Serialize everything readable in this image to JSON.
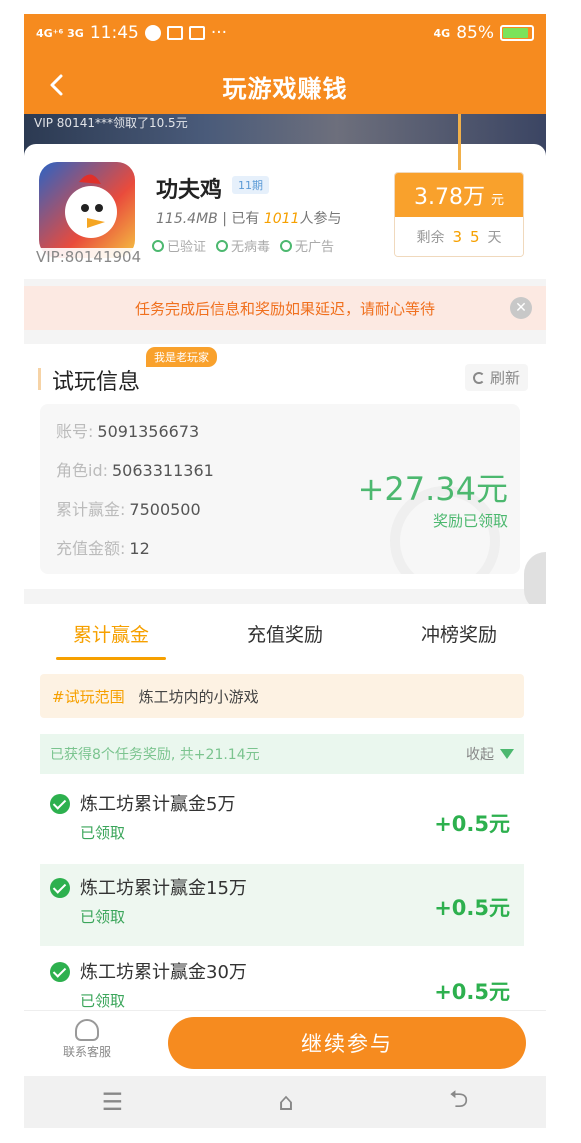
{
  "status_bar": {
    "network_left": "4G⁺⁶ 3G",
    "time": "11:45",
    "more": "···",
    "network_right": "4G",
    "battery": "85%",
    "battery_level": 0.85
  },
  "header": {
    "title": "玩游戏赚钱",
    "back_icon": "chevron-left-icon"
  },
  "banner": {
    "text": "VIP 80141***领取了10.5元"
  },
  "app": {
    "name": "功夫鸡",
    "period_badge": "11期",
    "size": "115.4MB",
    "participants_prefix": "| 已有",
    "participants_count": "1011",
    "participants_suffix": "人参与",
    "vip_id": "VIP:80141904",
    "tags": [
      "已验证",
      "无病毒",
      "无广告"
    ],
    "reward_total": "3.78万",
    "reward_unit": "元",
    "remaining_label": "剩余",
    "remaining_days_1": "3",
    "remaining_days_2": "5",
    "remaining_unit": "天"
  },
  "notice": {
    "text": "任务完成后信息和奖励如果延迟，请耐心等待"
  },
  "trial_info": {
    "title": "试玩信息",
    "badge": "我是老玩家",
    "refresh_label": "刷新",
    "rows": [
      {
        "key": "账号:",
        "value": "5091356673"
      },
      {
        "key": "角色id:",
        "value": "5063311361"
      },
      {
        "key": "累计赢金:",
        "value": "7500500"
      },
      {
        "key": "充值金额:",
        "value": "12"
      }
    ],
    "reward_amount": "+27.34元",
    "reward_status": "奖励已领取"
  },
  "tabs": [
    {
      "label": "累计赢金",
      "active": true
    },
    {
      "label": "充值奖励",
      "active": false
    },
    {
      "label": "冲榜奖励",
      "active": false
    }
  ],
  "range": {
    "key": "#试玩范围",
    "value": "炼工坊内的小游戏"
  },
  "summary": {
    "text": "已获得8个任务奖励, 共+21.14元",
    "collapse_label": "收起"
  },
  "tasks": [
    {
      "name": "炼工坊累计赢金5万",
      "status": "已领取",
      "reward": "+0.5元"
    },
    {
      "name": "炼工坊累计赢金15万",
      "status": "已领取",
      "reward": "+0.5元"
    },
    {
      "name": "炼工坊累计赢金30万",
      "status": "已领取",
      "reward": "+0.5元"
    }
  ],
  "bottom": {
    "service_label": "联系客服",
    "continue_label": "继续参与"
  },
  "nav": {
    "menu": "☰",
    "home": "⌂",
    "back": "⮌"
  },
  "colors": {
    "primary": "#f68b1f",
    "success": "#2db04e",
    "accent": "#f6a000"
  }
}
